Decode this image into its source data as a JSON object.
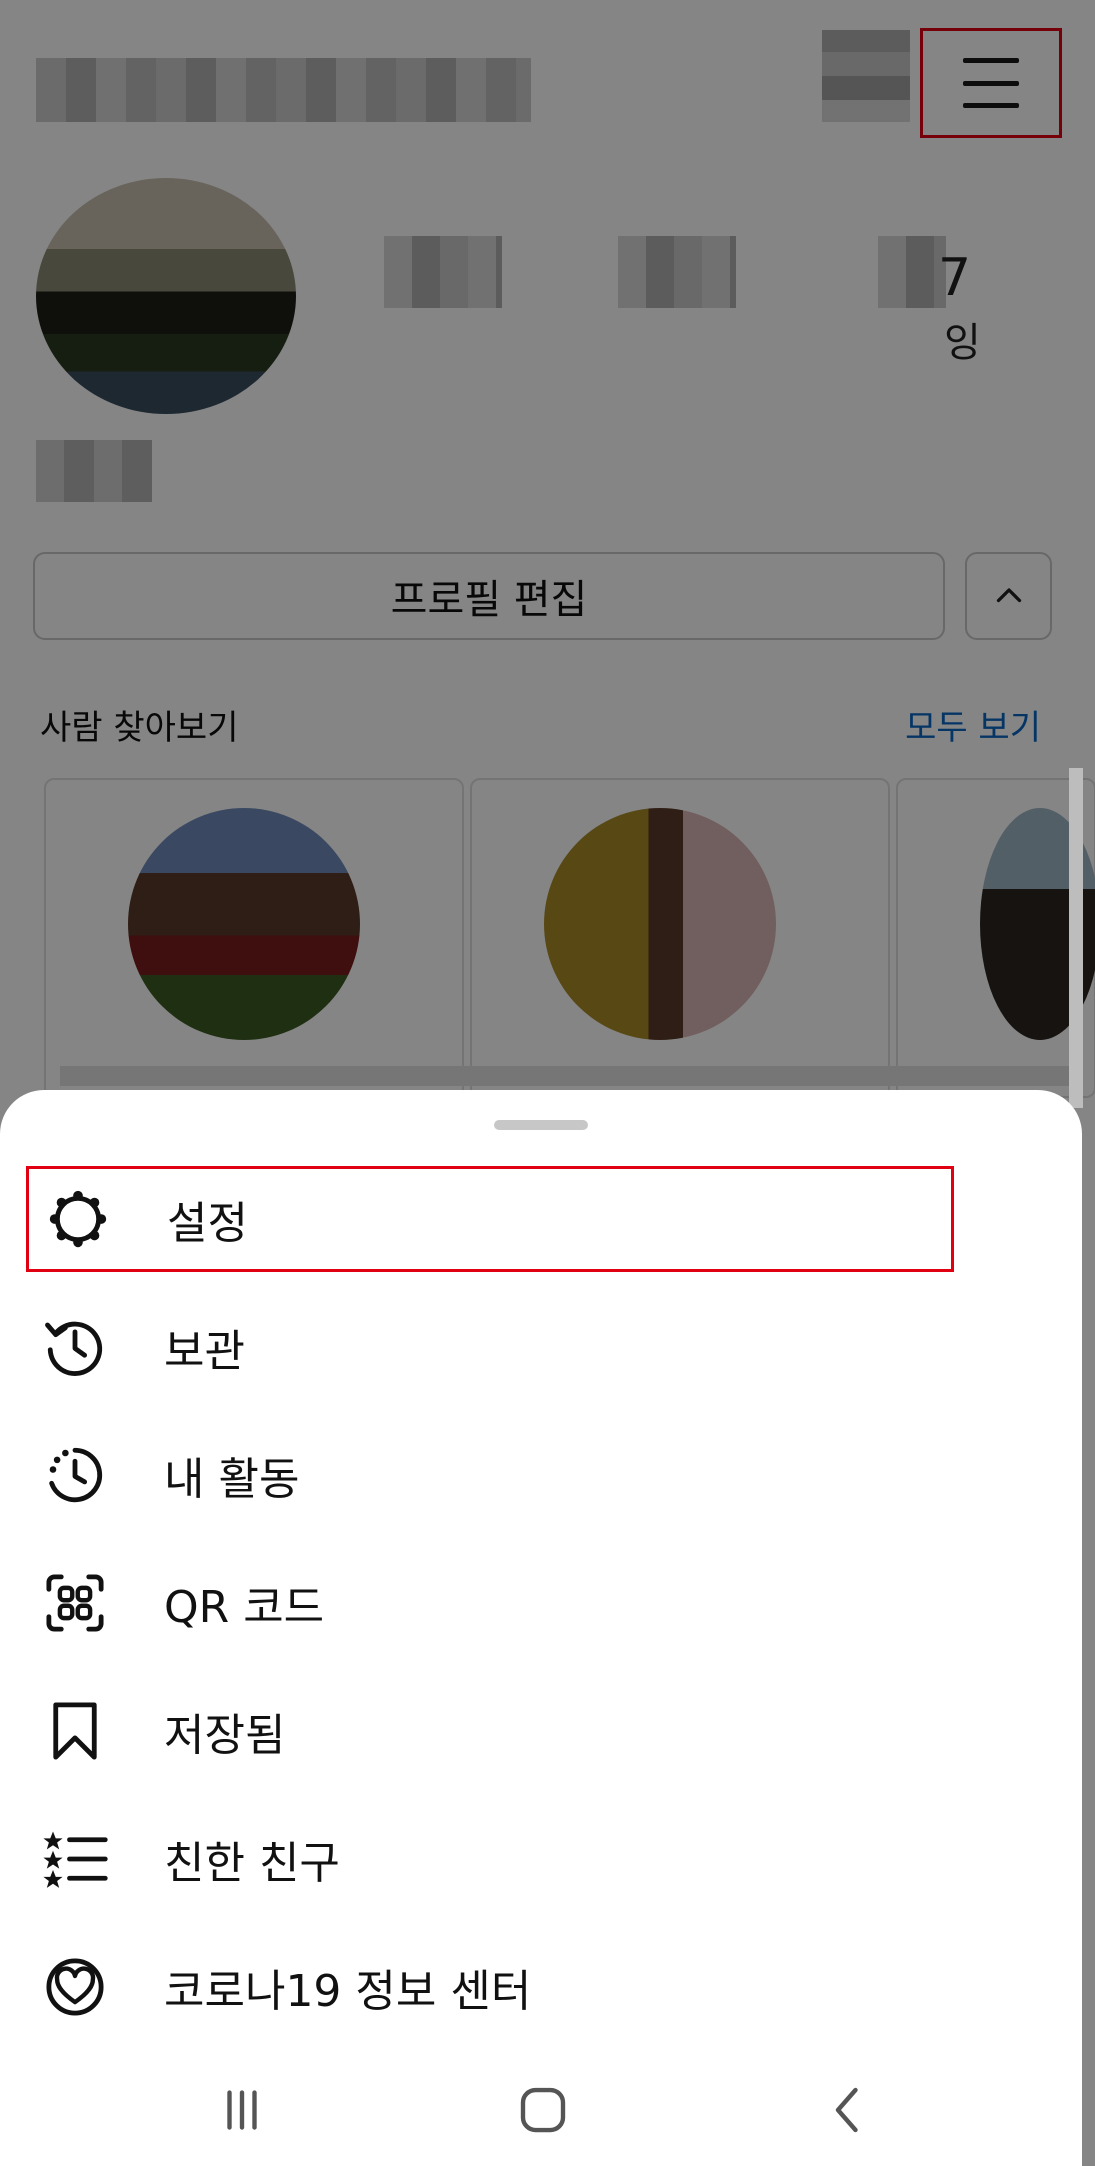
{
  "profile": {
    "stat_suffix": "잉",
    "stat_num_fragment": "7",
    "edit_profile_label": "프로필 편집",
    "toggle_icon": "chevron-up-icon",
    "discover_title": "사람 찾아보기",
    "see_all_label": "모두 보기"
  },
  "colors": {
    "highlight": "#e00012",
    "link": "#0a66c2",
    "overlay": "rgba(0,0,0,0.48)"
  },
  "menu": {
    "items": [
      {
        "label": "설정",
        "icon": "gear-icon"
      },
      {
        "label": "보관",
        "icon": "archive-history-icon"
      },
      {
        "label": "내 활동",
        "icon": "activity-clock-icon"
      },
      {
        "label": "QR 코드",
        "icon": "qr-code-icon"
      },
      {
        "label": "저장됨",
        "icon": "bookmark-icon"
      },
      {
        "label": "친한 친구",
        "icon": "close-friends-list-icon"
      },
      {
        "label": "코로나19 정보 센터",
        "icon": "covid-info-heart-icon"
      }
    ]
  },
  "navbar": {
    "recent_apps": "recent-apps-icon",
    "home": "home-icon",
    "back": "back-icon"
  }
}
